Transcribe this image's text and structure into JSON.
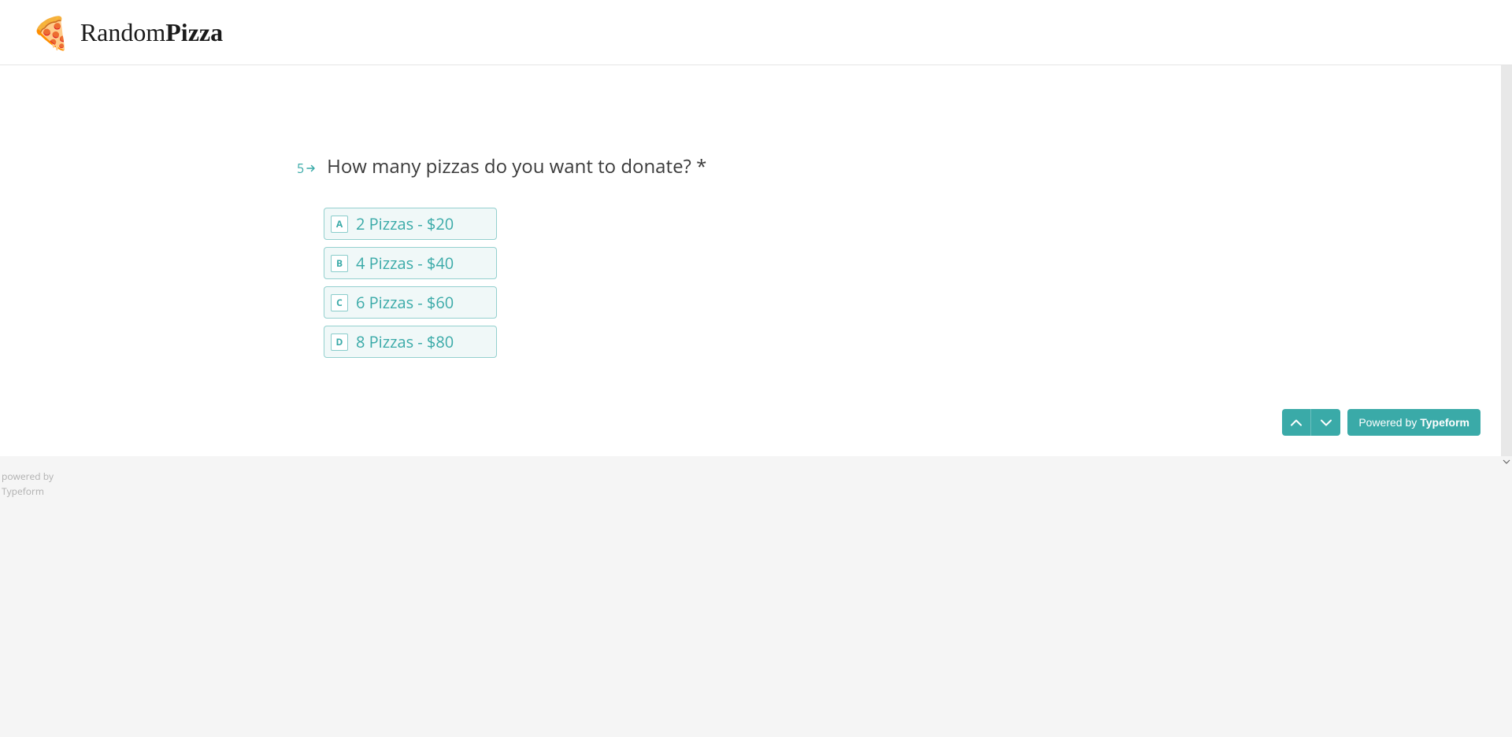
{
  "header": {
    "logo_prefix": "Random",
    "logo_suffix": "Pizza",
    "icon": "pizza-icon"
  },
  "form": {
    "question_number": "5",
    "question_text": "How many pizzas do you want to donate?",
    "required_marker": "*",
    "options": [
      {
        "key": "A",
        "label": "2 Pizzas - $20"
      },
      {
        "key": "B",
        "label": "4 Pizzas - $40"
      },
      {
        "key": "C",
        "label": "6 Pizzas - $60"
      },
      {
        "key": "D",
        "label": "8 Pizzas - $80"
      }
    ],
    "powered_by_prefix": "Powered by",
    "powered_by_brand": "Typeform"
  },
  "footer": {
    "line1": "powered by",
    "line2": "Typeform"
  },
  "colors": {
    "accent": "#3aaaa8"
  }
}
